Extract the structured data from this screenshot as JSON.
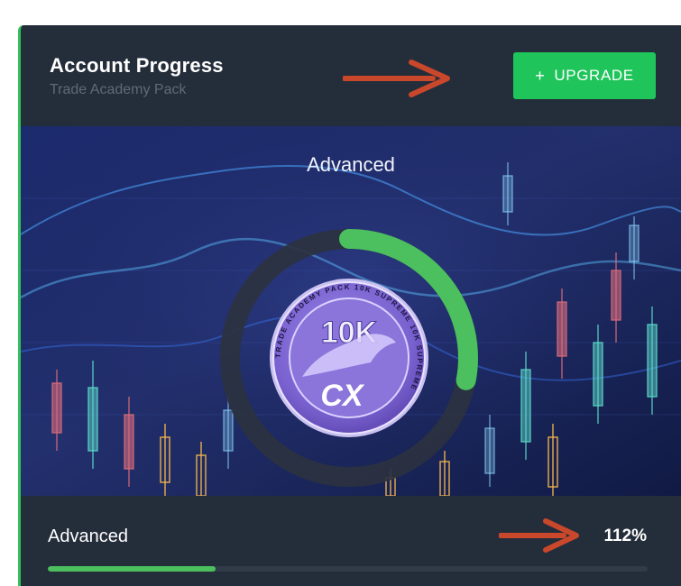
{
  "card": {
    "title": "Account Progress",
    "subtitle": "Trade Academy Pack",
    "upgrade_button": {
      "icon": "plus",
      "label": "UPGRADE"
    }
  },
  "hero": {
    "level_name": "Advanced",
    "ring_progress_fraction": 0.28,
    "badge": {
      "main_text": "10K",
      "ring_text": "TRADE ACADEMY PACK  10K  SUPREME  10K  SUPREME",
      "logo_text": "CX"
    }
  },
  "footer": {
    "level_label": "Advanced",
    "percent_text": "112%",
    "bar_fill_fraction": 0.28
  },
  "colors": {
    "card_bg": "#242d3a",
    "accent_green": "#1fc55a",
    "progress_green": "#4cbf5e",
    "arrow_red": "#c9472b",
    "subtitle_gray": "#5f6a78"
  },
  "icons": [
    "arrow-right-icon",
    "plus-icon",
    "badge-icon"
  ]
}
